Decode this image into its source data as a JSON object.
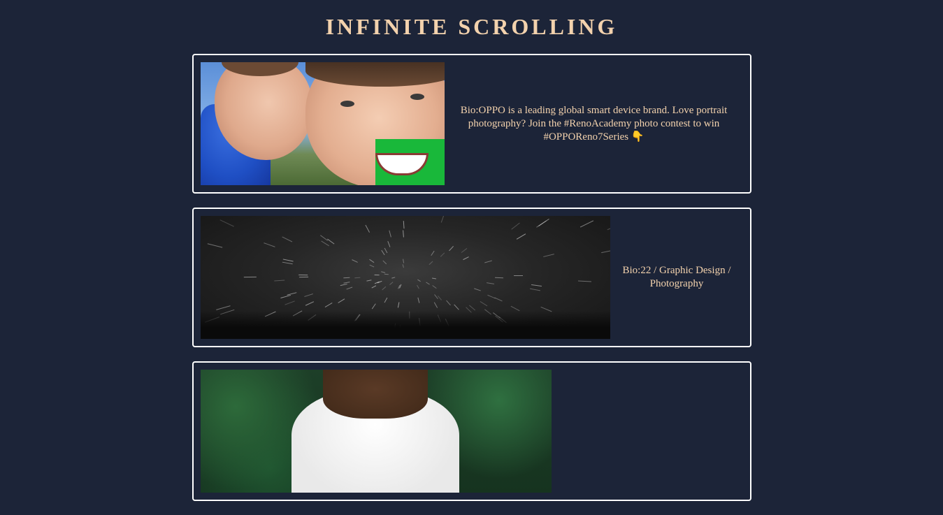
{
  "page": {
    "title": "INFINITE SCROLLING"
  },
  "posts": [
    {
      "bio": "Bio:OPPO is a leading global smart device brand. Love portrait photography? Join the #RenoAcademy photo contest to win #OPPOReno7Series 👇"
    },
    {
      "bio": "Bio:22 / Graphic Design / Photography"
    },
    {
      "bio": ""
    }
  ],
  "colors": {
    "background": "#1c2438",
    "accent_text": "#f3d2ad",
    "card_border": "#ffffff"
  }
}
